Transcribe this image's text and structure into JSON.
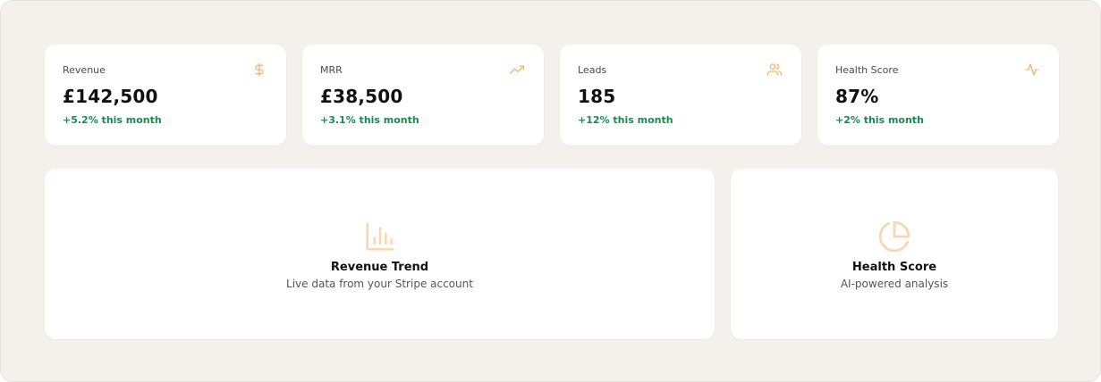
{
  "colors": {
    "background": "#f4f0eb",
    "card": "#ffffff",
    "accent": "#f6b56e",
    "accent_light": "#f9d7ae",
    "positive": "#1a8a52"
  },
  "stats": [
    {
      "label": "Revenue",
      "value": "£142,500",
      "change": "+5.2% this month",
      "icon": "dollar-icon"
    },
    {
      "label": "MRR",
      "value": "£38,500",
      "change": "+3.1% this month",
      "icon": "trending-up-icon"
    },
    {
      "label": "Leads",
      "value": "185",
      "change": "+12% this month",
      "icon": "users-icon"
    },
    {
      "label": "Health Score",
      "value": "87%",
      "change": "+2% this month",
      "icon": "activity-icon"
    }
  ],
  "panels": {
    "trend": {
      "title": "Revenue Trend",
      "subtitle": "Live data from your Stripe account",
      "icon": "bar-chart-icon"
    },
    "health": {
      "title": "Health Score",
      "subtitle": "AI-powered analysis",
      "icon": "pie-chart-icon"
    }
  }
}
